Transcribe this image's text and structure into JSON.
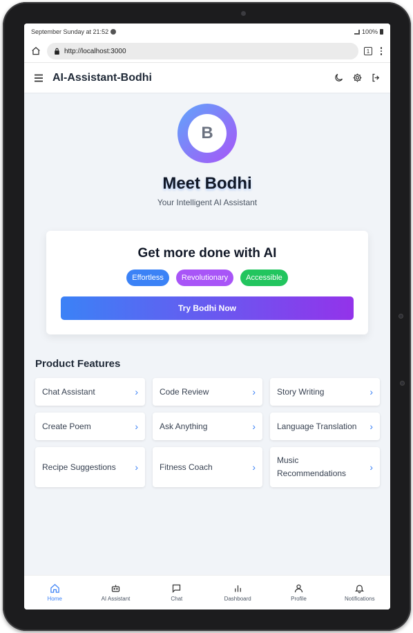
{
  "status": {
    "time": "September Sunday at 21:52",
    "battery": "100%"
  },
  "browser": {
    "url": "http://localhost:3000",
    "tab_count": "1"
  },
  "app": {
    "title": "AI-Assistant-Bodhi"
  },
  "hero": {
    "avatar_letter": "B",
    "title": "Meet Bodhi",
    "subtitle": "Your Intelligent AI Assistant"
  },
  "promo": {
    "title": "Get more done with AI",
    "pills": [
      {
        "label": "Effortless",
        "color": "#3b82f6"
      },
      {
        "label": "Revolutionary",
        "color": "#a855f7"
      },
      {
        "label": "Accessible",
        "color": "#22c55e"
      }
    ],
    "cta": "Try Bodhi Now"
  },
  "features": {
    "title": "Product Features",
    "items": [
      {
        "label": "Chat Assistant"
      },
      {
        "label": "Code Review"
      },
      {
        "label": "Story Writing"
      },
      {
        "label": "Create Poem"
      },
      {
        "label": "Ask Anything"
      },
      {
        "label": "Language Translation"
      },
      {
        "label": "Recipe Suggestions"
      },
      {
        "label": "Fitness Coach"
      },
      {
        "label": "Music Recommendations"
      }
    ]
  },
  "nav": {
    "items": [
      {
        "label": "Home",
        "icon": "home-icon",
        "active": true
      },
      {
        "label": "AI Assistant",
        "icon": "bot-icon"
      },
      {
        "label": "Chat",
        "icon": "chat-icon"
      },
      {
        "label": "Dashboard",
        "icon": "chart-icon"
      },
      {
        "label": "Profile",
        "icon": "user-icon"
      },
      {
        "label": "Notifications",
        "icon": "bell-icon"
      }
    ]
  },
  "colors": {
    "accent": "#3b82f6",
    "gradient_end": "#9333ea"
  }
}
